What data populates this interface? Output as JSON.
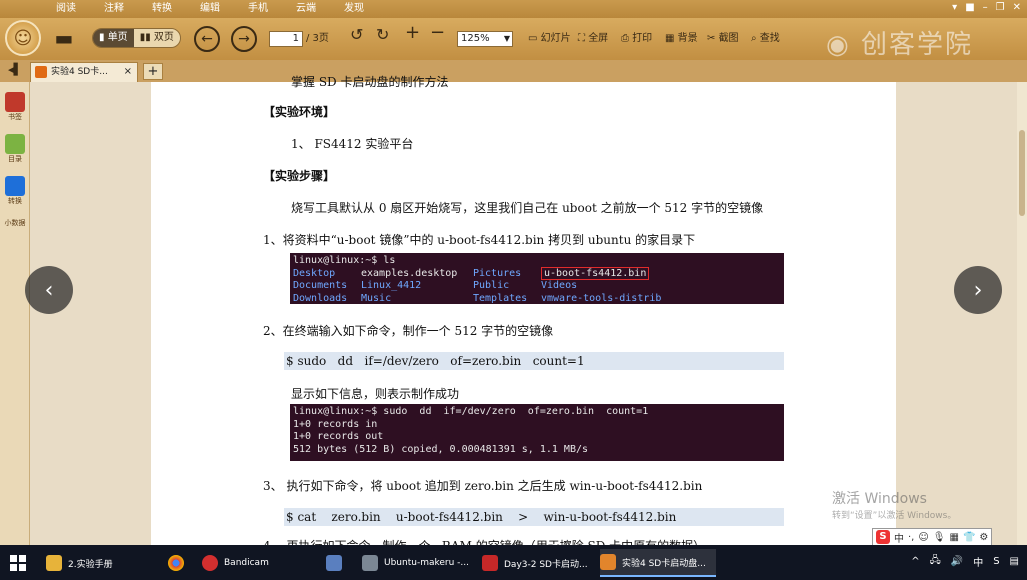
{
  "menu": {
    "items": [
      "阅读",
      "注释",
      "转换",
      "编辑",
      "手机",
      "云端",
      "发现"
    ],
    "window_controls": [
      "▾",
      "■",
      "–",
      "❐",
      "✕"
    ]
  },
  "toolbar": {
    "single_page": "单页",
    "double_page": "双页",
    "current_page": "1",
    "total_pages": "/ 3页",
    "zoom": "125%",
    "slideshow": "幻灯片",
    "fullscreen": "全屏",
    "print": "打印",
    "background": "背景",
    "screenshot": "截图",
    "find": "查找",
    "brand": "创客学院"
  },
  "tabs": {
    "current": "实验4 SD卡...",
    "close": "×",
    "new": "+"
  },
  "sidebar": {
    "items": [
      "书签",
      "目录",
      "转换"
    ],
    "cloud": "小数据"
  },
  "document": {
    "top_cut": "掌握 SD 卡启动盘的制作方法",
    "h_env": "【实验环境】",
    "env_item": "1、 FS4412 实验平台",
    "h_steps": "【实验步骤】",
    "intro": "烧写工具默认从 0 扇区开始烧写，这里我们自己在 uboot 之前放一个 512 字节的空镜像",
    "step1": "1、将资料中“u-boot 镜像”中的 u-boot-fs4412.bin 拷贝到 ubuntu 的家目录下",
    "term1": {
      "prompt": "linux@linux:~$ ls",
      "rows": [
        [
          "Desktop",
          "examples.desktop",
          "Pictures",
          "u-boot-fs4412.bin"
        ],
        [
          "Documents",
          "Linux_4412",
          "Public",
          "Videos"
        ],
        [
          "Downloads",
          "Music",
          "Templates",
          "vmware-tools-distrib"
        ]
      ]
    },
    "step2": "2、在终端输入如下命令，制作一个 512 字节的空镜像",
    "cmd2": "$ sudo   dd   if=/dev/zero   of=zero.bin   count=1",
    "note2": "显示如下信息，则表示制作成功",
    "term2": [
      "linux@linux:~$ sudo  dd  if=/dev/zero  of=zero.bin  count=1",
      "1+0 records in",
      "1+0 records out",
      "512 bytes (512 B) copied, 0.000481391 s, 1.1 MB/s"
    ],
    "step3": "3、  执行如下命令，将 uboot 追加到 zero.bin 之后生成 win-u-boot-fs4412.bin",
    "cmd3": "$ cat    zero.bin    u-boot-fs4412.bin    >    win-u-boot-fs4412.bin",
    "step4_cut": "4、  再执行如下命令，制作一个...RAM 的空镜像（用于擦除 SD 卡中原有的数据）"
  },
  "overlay": {
    "activate_title": "激活 Windows",
    "activate_sub": "转到“设置”以激活 Windows。",
    "prev": "‹",
    "next": "›"
  },
  "taskbar": {
    "items": [
      "2.实验手册",
      "Bandicam",
      "Ubuntu-makeru -...",
      "Day3-2 SD卡启动...",
      "实验4 SD卡启动盘..."
    ],
    "ime": [
      "中",
      "·,",
      "☺",
      "🎙",
      "▦",
      "👕",
      "⚙"
    ],
    "tray": [
      "^",
      "🖧",
      "🔊",
      "中",
      "S",
      "▤"
    ]
  },
  "colors": {
    "terminal_bg": "#2e0f22",
    "accent": "#c28f42",
    "folder_blue": "#6fa8ff"
  }
}
